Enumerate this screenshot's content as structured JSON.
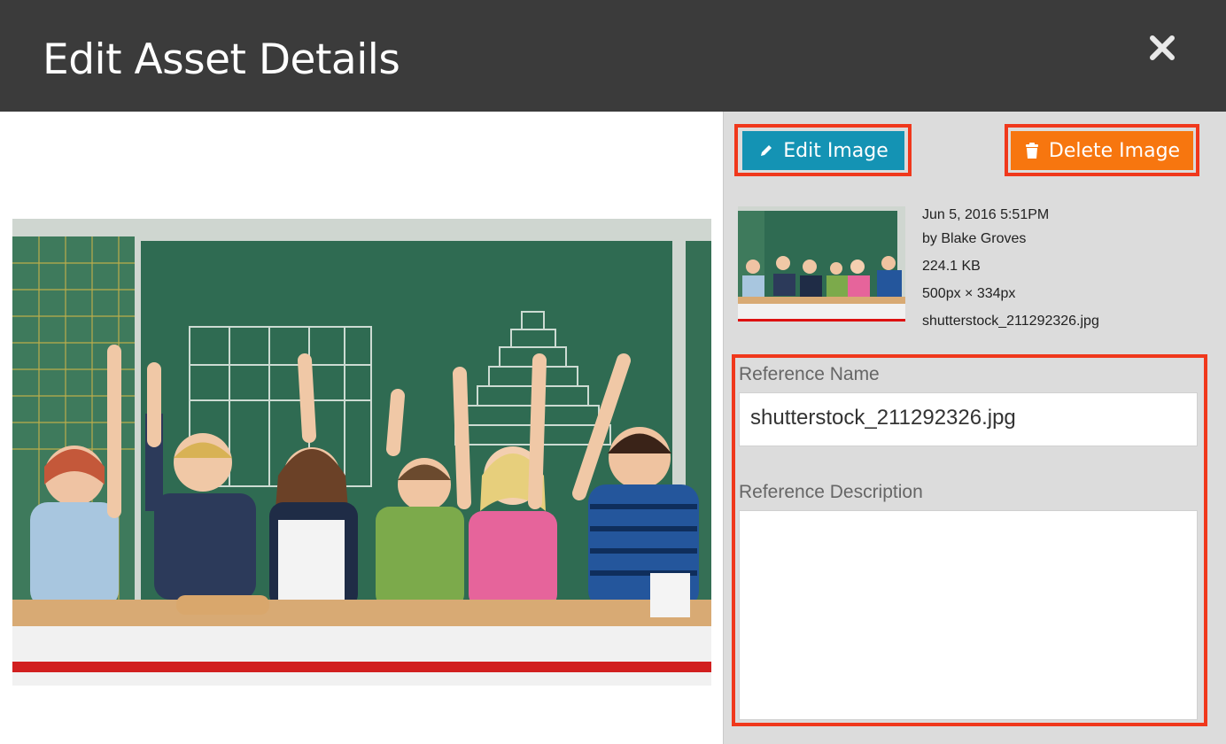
{
  "dialog": {
    "title": "Edit Asset Details",
    "close_icon": "close-icon"
  },
  "toolbar": {
    "edit_label": "Edit Image",
    "edit_icon": "pencil-icon",
    "delete_label": "Delete Image",
    "delete_icon": "trash-icon"
  },
  "asset": {
    "date": "Jun 5, 2016 5:51PM",
    "author": "by Blake Groves",
    "size": "224.1 KB",
    "dimensions": "500px × 334px",
    "filename": "shutterstock_211292326.jpg"
  },
  "form": {
    "reference_name_label": "Reference Name",
    "reference_name_value": "shutterstock_211292326.jpg",
    "reference_description_label": "Reference Description",
    "reference_description_value": ""
  },
  "colors": {
    "header_bg": "#3b3b3b",
    "edit_button": "#1493b4",
    "delete_button": "#f7760f",
    "highlight": "#f0381c"
  }
}
